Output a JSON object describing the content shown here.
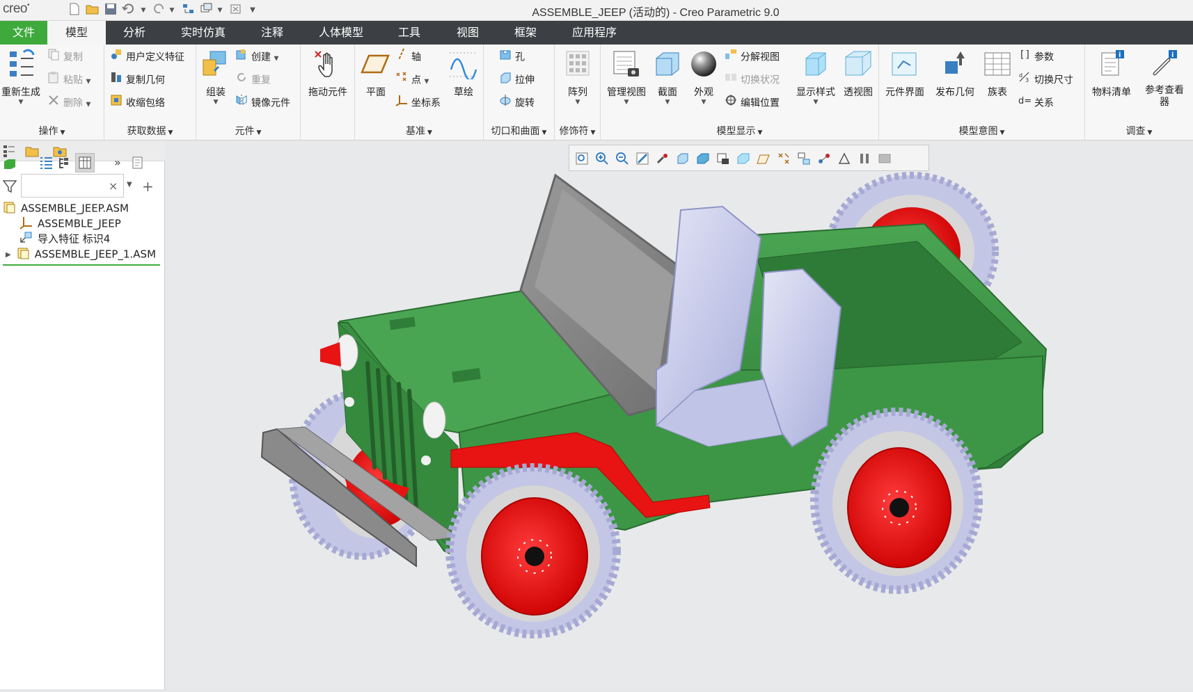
{
  "app": {
    "logo": "creo",
    "title": "ASSEMBLE_JEEP (活动的) - Creo Parametric 9.0"
  },
  "menu": {
    "tabs": [
      "文件",
      "模型",
      "分析",
      "实时仿真",
      "注释",
      "人体模型",
      "工具",
      "视图",
      "框架",
      "应用程序"
    ],
    "active": "模型"
  },
  "ribbon": {
    "ops": {
      "regen": "重新生成",
      "copy": "复制",
      "paste": "粘贴",
      "delete": "删除",
      "label": "操作"
    },
    "getdata": {
      "udf": "用户定义特征",
      "copygeom": "复制几何",
      "shrink": "收缩包络",
      "label": "获取数据"
    },
    "component": {
      "assemble": "组装",
      "create": "创建",
      "repeat": "重复",
      "mirror": "镜像元件",
      "label": "元件"
    },
    "drag": {
      "label": "拖动元件"
    },
    "datum": {
      "plane": "平面",
      "axis": "轴",
      "point": "点",
      "csys": "坐标系",
      "sketch": "草绘",
      "label": "基准"
    },
    "cut": {
      "hole": "孔",
      "extrude": "拉伸",
      "revolve": "旋转",
      "label": "切口和曲面"
    },
    "modifier": {
      "pattern": "阵列",
      "label": "修饰符"
    },
    "display": {
      "manage": "管理视图",
      "section": "截面",
      "appearance": "外观",
      "explode": "分解视图",
      "toggle": "切换状况",
      "editpos": "编辑位置",
      "style": "显示样式",
      "perspective": "透视图",
      "label": "模型显示"
    },
    "intent": {
      "interface": "元件界面",
      "publish": "发布几何",
      "family": "族表",
      "param": "参数",
      "switchdim": "切换尺寸",
      "relations": "关系",
      "label": "模型意图"
    },
    "investigate": {
      "bom": "物料清单",
      "refviewer": "参考查看器",
      "label": "调查"
    }
  },
  "tree": {
    "items": [
      "ASSEMBLE_JEEP.ASM",
      "ASSEMBLE_JEEP",
      "导入特征 标识4",
      "ASSEMBLE_JEEP_1.ASM"
    ]
  },
  "colors": {
    "body": "#3f9a48",
    "accent_red": "#e81313",
    "tire": "#c9cbe4",
    "seat": "#c9cde9",
    "frame": "#8a8a8a",
    "file_tab": "#3eaa3c",
    "menubar": "#3c4044"
  }
}
